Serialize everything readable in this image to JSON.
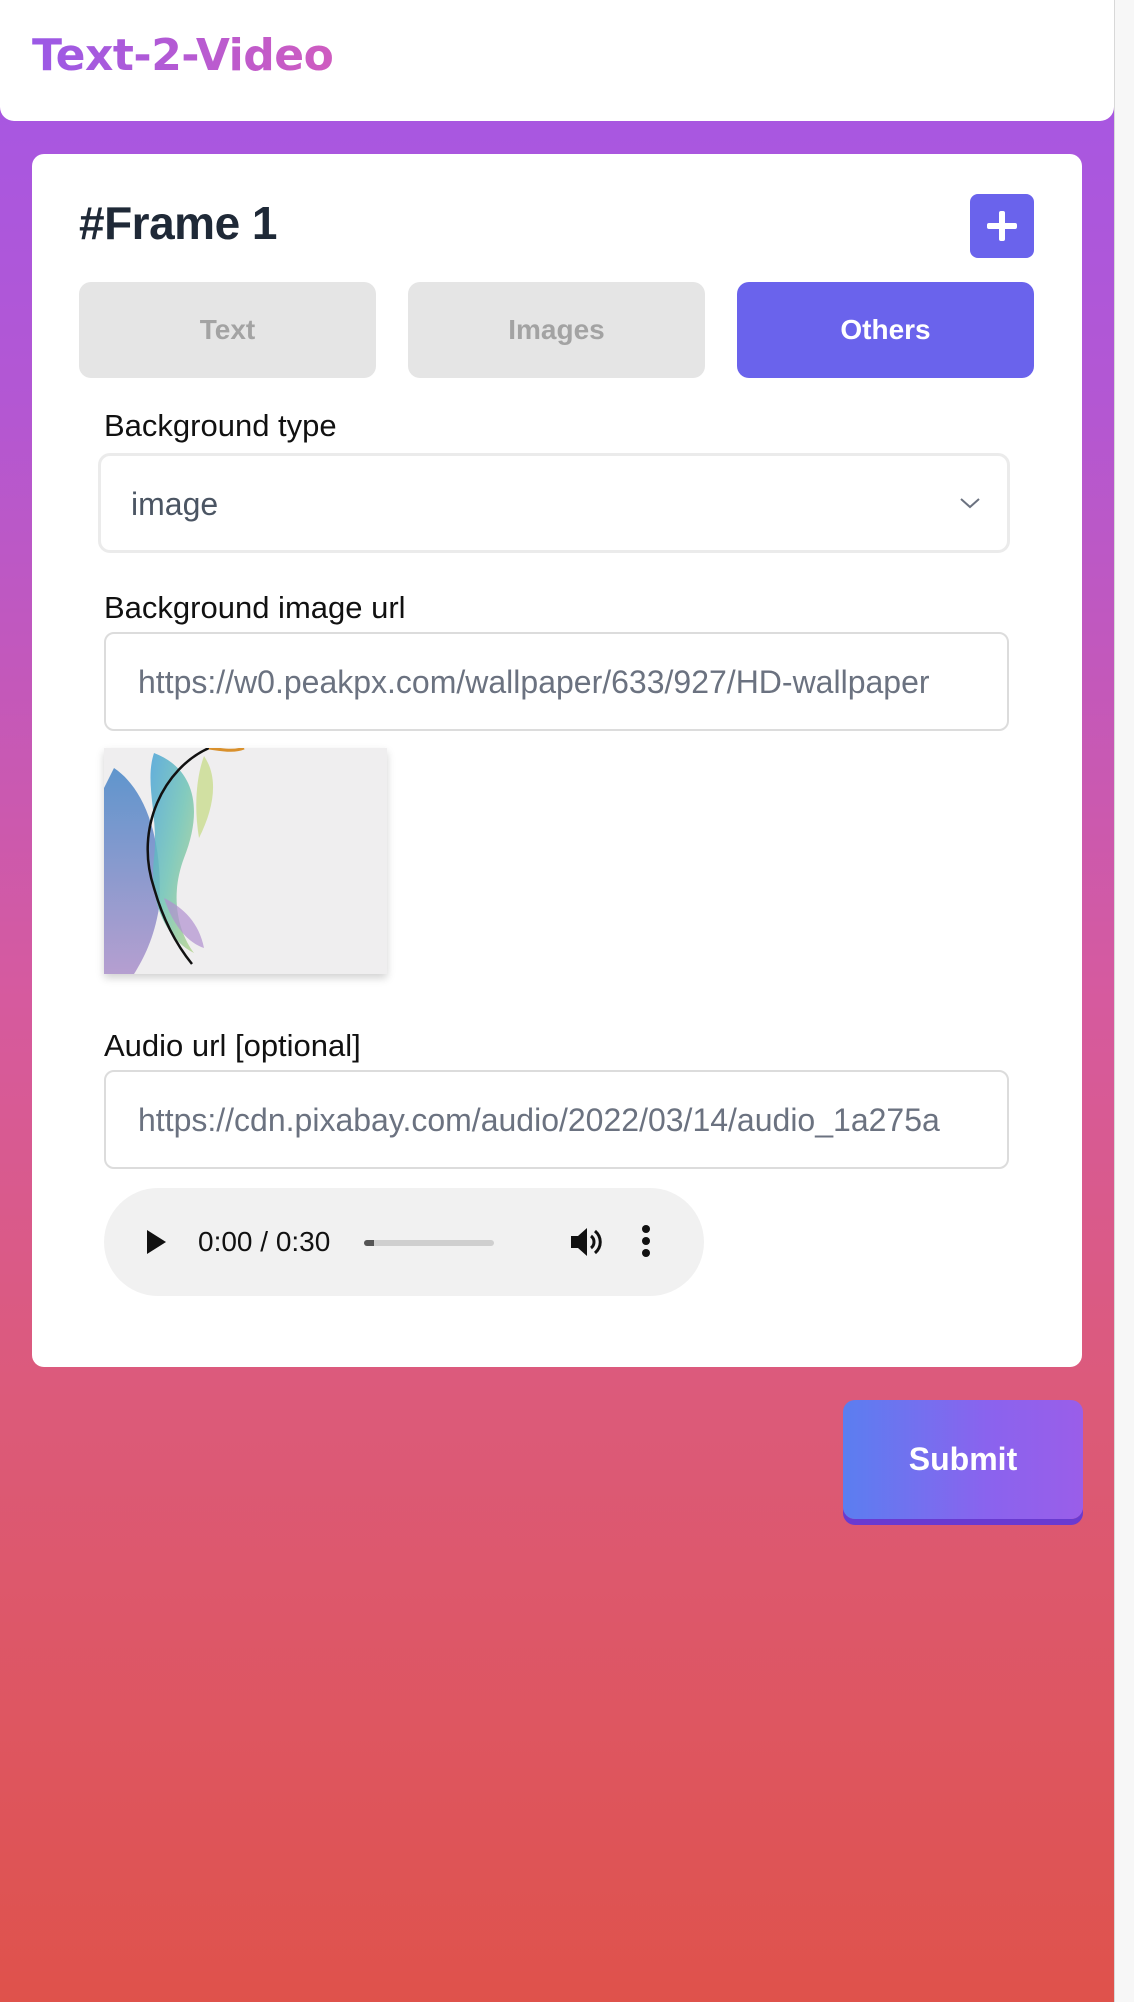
{
  "app": {
    "title": "Text-2-Video"
  },
  "frame": {
    "title": "#Frame 1",
    "tabs": [
      {
        "label": "Text",
        "active": false
      },
      {
        "label": "Images",
        "active": false
      },
      {
        "label": "Others",
        "active": true
      }
    ]
  },
  "background_type": {
    "label": "Background type",
    "value": "image",
    "icon": "chevron-down-icon"
  },
  "background_image_url": {
    "label": "Background image url",
    "value": "https://w0.peakpx.com/wallpaper/633/927/HD-wallpaper"
  },
  "audio_url": {
    "label": "Audio url [optional]",
    "value": "https://cdn.pixabay.com/audio/2022/03/14/audio_1a275a"
  },
  "audio_player": {
    "time": "0:00 / 0:30",
    "progress_fraction": 0.08
  },
  "submit": {
    "label": "Submit"
  },
  "colors": {
    "accent": "#6a63ec",
    "brand_gradient_start": "#9b59e6",
    "brand_gradient_end": "#cf5cc0",
    "page_gradient_top": "#a457e6",
    "page_gradient_bottom": "#df524b",
    "inactive_tab": "#e5e5e5"
  }
}
